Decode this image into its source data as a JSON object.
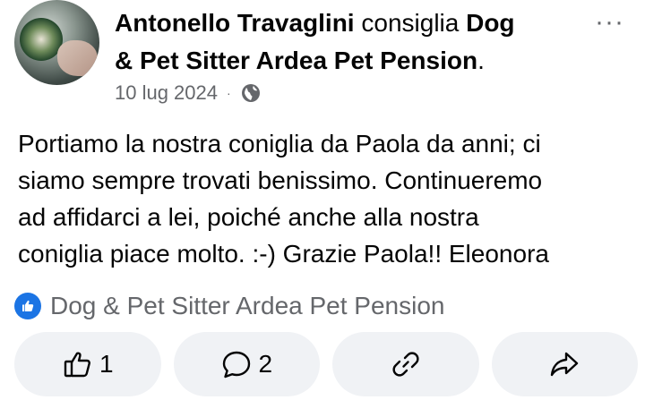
{
  "post": {
    "author": "Antonello Travaglini",
    "verb": "consiglia",
    "page_line1": "Dog",
    "page_line2": "& Pet Sitter Ardea Pet Pension",
    "period": ".",
    "date": "10 lug 2024",
    "separator": "·",
    "privacy_icon": "globe-icon",
    "more_label": "···",
    "body_lines": [
      "Portiamo la nostra coniglia da Paola da anni; ci",
      "siamo sempre trovati benissimo. Continueremo",
      "ad affidarci a lei, poiché anche alla nostra",
      "coniglia piace molto. :-) Grazie Paola!! Eleonora"
    ],
    "recommendation": {
      "icon": "thumbs-up-badge-icon",
      "label": "Dog & Pet Sitter Ardea Pet Pension"
    }
  },
  "actions": {
    "like_count": "1",
    "comment_count": "2",
    "like_icon": "thumbs-up-icon",
    "comment_icon": "comment-bubble-icon",
    "copy_link_icon": "link-icon",
    "share_icon": "share-arrow-icon"
  },
  "colors": {
    "accent": "#1b74e4",
    "muted_text": "#65676b",
    "button_bg": "#f0f2f5"
  }
}
